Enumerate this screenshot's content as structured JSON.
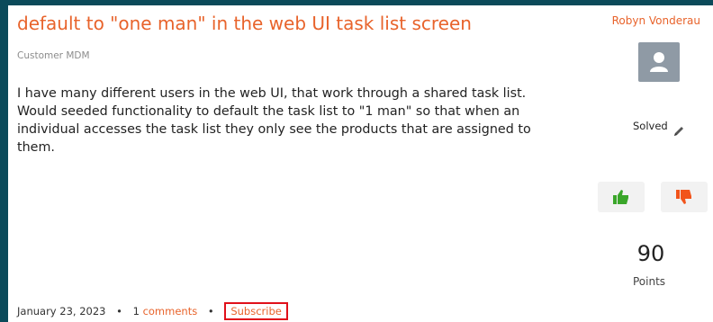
{
  "post": {
    "title": "default to \"one man\" in the web UI task list screen",
    "author": "Robyn Vonderau",
    "category": "Customer MDM",
    "body": "I have many different users in the web UI, that work through a shared task list. Would seeded functionality to default the task list to \"1 man\" so that when an individual accesses the task list they only see the products that are assigned to them.",
    "status": "Solved",
    "points": "90",
    "points_label": "Points"
  },
  "footer": {
    "date": "January 23, 2023",
    "separator": "•",
    "comment_count": "1",
    "comments_label": "comments",
    "subscribe_label": "Subscribe"
  },
  "colors": {
    "accent": "#e8632b",
    "upvote": "#3aa62a",
    "downvote": "#f2541b",
    "background": "#0b4a5a",
    "highlight_box": "#e0101a"
  },
  "icons": {
    "avatar": "user-avatar-icon",
    "edit": "pencil-icon",
    "upvote": "thumbs-up-icon",
    "downvote": "thumbs-down-icon"
  }
}
